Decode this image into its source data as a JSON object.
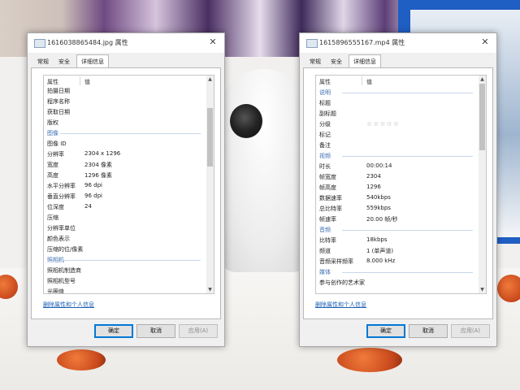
{
  "left_dialog": {
    "title": "1616038865484.jpg 属性",
    "tabs": [
      "常规",
      "安全",
      "详细信息"
    ],
    "active_tab": 2,
    "header": {
      "name": "属性",
      "value": "值"
    },
    "rows": [
      {
        "k": "拍摄日期",
        "v": "",
        "sec": false
      },
      {
        "k": "程序名称",
        "v": "",
        "sec": false
      },
      {
        "k": "获取日期",
        "v": "",
        "sec": false
      },
      {
        "k": "版权",
        "v": "",
        "sec": false
      },
      {
        "k": "图像",
        "v": "",
        "sec": true
      },
      {
        "k": "图像 ID",
        "v": "",
        "sec": false
      },
      {
        "k": "分辨率",
        "v": "2304 x 1296",
        "sec": false
      },
      {
        "k": "宽度",
        "v": "2304 像素",
        "sec": false
      },
      {
        "k": "高度",
        "v": "1296 像素",
        "sec": false
      },
      {
        "k": "水平分辨率",
        "v": "96 dpi",
        "sec": false
      },
      {
        "k": "垂直分辨率",
        "v": "96 dpi",
        "sec": false
      },
      {
        "k": "位深度",
        "v": "24",
        "sec": false
      },
      {
        "k": "压缩",
        "v": "",
        "sec": false
      },
      {
        "k": "分辨率单位",
        "v": "",
        "sec": false
      },
      {
        "k": "颜色表示",
        "v": "",
        "sec": false
      },
      {
        "k": "压缩的位/像素",
        "v": "",
        "sec": false
      },
      {
        "k": "照相机",
        "v": "",
        "sec": true
      },
      {
        "k": "照相机制造商",
        "v": "",
        "sec": false
      },
      {
        "k": "照相机型号",
        "v": "",
        "sec": false
      },
      {
        "k": "光圈值",
        "v": "",
        "sec": false
      }
    ],
    "remove_link": "删除属性和个人信息",
    "buttons": {
      "ok": "确定",
      "cancel": "取消",
      "apply": "应用(A)"
    }
  },
  "right_dialog": {
    "title": "1615896555167.mp4 属性",
    "tabs": [
      "常规",
      "安全",
      "详细信息"
    ],
    "active_tab": 2,
    "header": {
      "name": "属性",
      "value": "值"
    },
    "rows": [
      {
        "k": "说明",
        "v": "",
        "sec": true
      },
      {
        "k": "标题",
        "v": "",
        "sec": false
      },
      {
        "k": "副标题",
        "v": "",
        "sec": false
      },
      {
        "k": "分级",
        "v": "☆☆☆☆☆",
        "sec": false,
        "stars": true
      },
      {
        "k": "标记",
        "v": "",
        "sec": false
      },
      {
        "k": "备注",
        "v": "",
        "sec": false
      },
      {
        "k": "视频",
        "v": "",
        "sec": true
      },
      {
        "k": "时长",
        "v": "00:00:14",
        "sec": false
      },
      {
        "k": "帧宽度",
        "v": "2304",
        "sec": false
      },
      {
        "k": "帧高度",
        "v": "1296",
        "sec": false
      },
      {
        "k": "数据速率",
        "v": "540kbps",
        "sec": false
      },
      {
        "k": "总比特率",
        "v": "559kbps",
        "sec": false
      },
      {
        "k": "帧速率",
        "v": "20.00 帧/秒",
        "sec": false
      },
      {
        "k": "音频",
        "v": "",
        "sec": true
      },
      {
        "k": "比特率",
        "v": "18kbps",
        "sec": false
      },
      {
        "k": "频道",
        "v": "1 (单声道)",
        "sec": false
      },
      {
        "k": "音频采样频率",
        "v": "8.000 kHz",
        "sec": false
      },
      {
        "k": "媒体",
        "v": "",
        "sec": true
      },
      {
        "k": "参与创作的艺术家",
        "v": "",
        "sec": false
      }
    ],
    "remove_link": "删除属性和个人信息",
    "buttons": {
      "ok": "确定",
      "cancel": "取消",
      "apply": "应用(A)"
    }
  },
  "icons": {
    "close": "close-icon",
    "file": "file-icon",
    "scroll_up": "arrow-up-icon",
    "scroll_down": "arrow-down-icon"
  }
}
